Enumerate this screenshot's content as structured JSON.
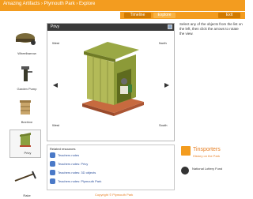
{
  "header": {
    "breadcrumb": "Amazing Artifacts › Plymouth Park › Explore",
    "nav": {
      "btn1": "Timeline",
      "btn2": "Explore",
      "btn3": "Exit"
    }
  },
  "sidebar": {
    "items": [
      {
        "label": "Wheelbarrow"
      },
      {
        "label": "Garden Pump"
      },
      {
        "label": "Beehive"
      },
      {
        "label": "Privy"
      },
      {
        "label": "Rake"
      }
    ]
  },
  "viewer": {
    "title": "Privy",
    "directions": {
      "nw": "West",
      "ne": "North",
      "sw": "West",
      "se": "South",
      "w": "W",
      "e": "E"
    }
  },
  "related": {
    "title": "Related resources",
    "items": [
      {
        "label": "Teachers notes"
      },
      {
        "label": "Teachers notes: Privy"
      },
      {
        "label": "Teachers notes: 3D objects"
      },
      {
        "label": "Teachers notes: Plymouth Park"
      }
    ]
  },
  "right": {
    "instructions": "Select any of the objects from the list on the left, then click the arrows to rotate the view."
  },
  "brand": {
    "name": "Tinsporters",
    "tag": "History on the Park",
    "partner": "National Lottery Fund"
  },
  "footer": {
    "text": "Copyright © Plymouth Park"
  }
}
